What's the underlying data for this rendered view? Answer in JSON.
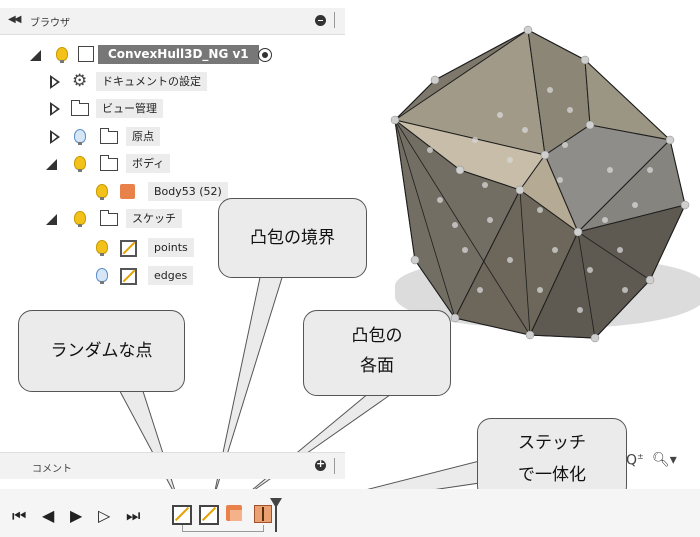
{
  "browser": {
    "title": "ブラウザ",
    "collapse_glyph": "◀◀",
    "root": "ConvexHull3D_NG v1",
    "items": [
      {
        "label": "ドキュメントの設定",
        "icon": "gear-icon"
      },
      {
        "label": "ビュー管理",
        "icon": "folder-icon"
      },
      {
        "label": "原点",
        "icon": "folder-icon"
      },
      {
        "label": "ボディ",
        "icon": "folder-icon"
      },
      {
        "label": "Body53 (52)",
        "icon": "body-icon"
      },
      {
        "label": "スケッチ",
        "icon": "folder-icon"
      },
      {
        "label": "points",
        "icon": "sketch-icon"
      },
      {
        "label": "edges",
        "icon": "sketch-icon"
      }
    ]
  },
  "callouts": {
    "random_points": "ランダムな点",
    "hull_boundary": "凸包の境界",
    "hull_faces_1": "凸包の",
    "hull_faces_2": "各面",
    "stitch_1": "ステッチ",
    "stitch_2": "で一体化"
  },
  "comment": {
    "title": "コメント"
  },
  "colors": {
    "panel_bg": "#f2f2f2",
    "bulb_on": "#f2c21b",
    "bulb_off": "#d6e6f7",
    "hull_face": "#7d786b"
  }
}
